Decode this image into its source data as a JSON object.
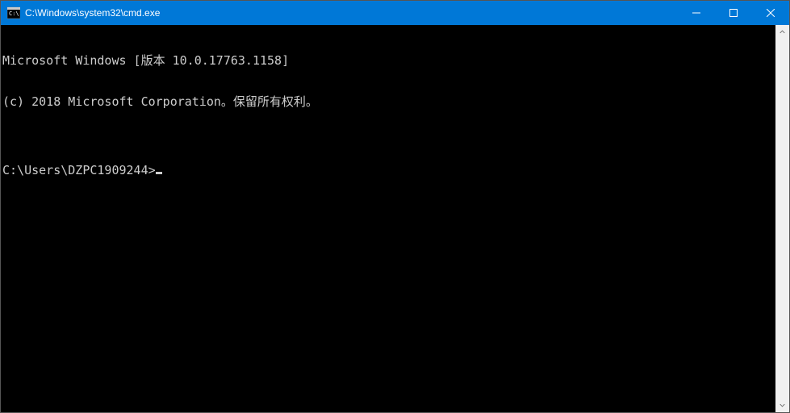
{
  "window": {
    "title": "C:\\Windows\\system32\\cmd.exe"
  },
  "terminal": {
    "line1": "Microsoft Windows [版本 10.0.17763.1158]",
    "line2": "(c) 2018 Microsoft Corporation。保留所有权利。",
    "blank": "",
    "prompt": "C:\\Users\\DZPC1909244>"
  }
}
